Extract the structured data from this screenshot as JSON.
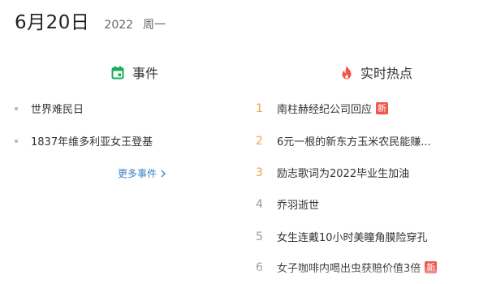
{
  "date": {
    "main": "6月20日",
    "year": "2022",
    "weekday": "周一"
  },
  "events": {
    "title": "事件",
    "items": [
      "世界难民日",
      "1837年维多利亚女王登基"
    ],
    "more_label": "更多事件",
    "icon_color": "#1aad5b"
  },
  "hot": {
    "title": "实时热点",
    "icon_color": "#f0544a",
    "items": [
      {
        "rank": "1",
        "text": "南柱赫经纪公司回应",
        "badge": "新"
      },
      {
        "rank": "2",
        "text": " 6元一根的新东方玉米农民能赚...",
        "badge": ""
      },
      {
        "rank": "3",
        "text": "励志歌词为2022毕业生加油",
        "badge": ""
      },
      {
        "rank": "4",
        "text": "乔羽逝世",
        "badge": ""
      },
      {
        "rank": "5",
        "text": "女生连戴10小时美瞳角膜险穿孔",
        "badge": ""
      },
      {
        "rank": "6",
        "text": "女子咖啡内喝出虫获赔价值3倍",
        "badge": "新"
      }
    ]
  },
  "colors": {
    "accent_rank": "#f0a04b",
    "link": "#3b82c4",
    "badge": "#f0544a"
  }
}
